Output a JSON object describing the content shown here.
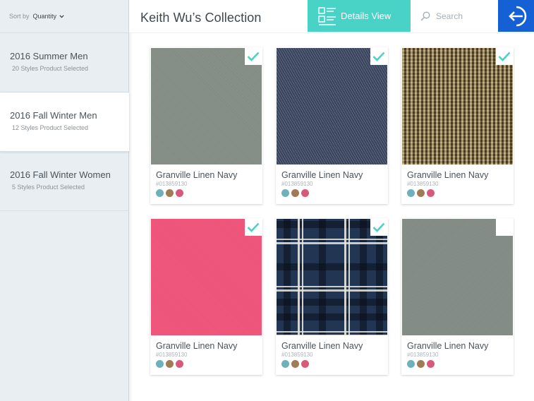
{
  "sidebar": {
    "sort_label": "Sort by",
    "sort_value": "Quantity",
    "collections": [
      {
        "name": "2016 Summer Men",
        "count": "20 Styles Product Selected",
        "active": false
      },
      {
        "name": "2016 Fall Winter Men",
        "count": "12 Styles Product Selected",
        "active": true
      },
      {
        "name": "2016 Fall Winter Women",
        "count": "5 Styles Product Selected",
        "active": false
      }
    ]
  },
  "header": {
    "title": "Keith Wu’s Collection",
    "details_label": "Details View",
    "search_placeholder": "Search",
    "search_value": ""
  },
  "colors": {
    "accent": "#49d3c7",
    "exit_button": "#1560d4",
    "dot_teal": "#6fb1bb",
    "dot_brown": "#a07b55",
    "dot_pink": "#d75a7c"
  },
  "products": [
    {
      "name": "Granville Linen Navy",
      "code": "#013859130",
      "fabric": "gray",
      "selected": true,
      "dots": [
        "#6fb1bb",
        "#a07b55",
        "#d75a7c"
      ]
    },
    {
      "name": "Granville Linen Navy",
      "code": "#013859130",
      "fabric": "denim",
      "selected": true,
      "dots": [
        "#6fb1bb",
        "#a07b55",
        "#d75a7c"
      ]
    },
    {
      "name": "Granville Linen Navy",
      "code": "#013859130",
      "fabric": "tweed",
      "selected": true,
      "dots": [
        "#6fb1bb",
        "#a07b55",
        "#d75a7c"
      ]
    },
    {
      "name": "Granville Linen Navy",
      "code": "#013859130",
      "fabric": "pink",
      "selected": true,
      "dots": [
        "#6fb1bb",
        "#a07b55",
        "#d75a7c"
      ]
    },
    {
      "name": "Granville Linen Navy",
      "code": "#013859130",
      "fabric": "plaid",
      "selected": true,
      "dots": [
        "#6fb1bb",
        "#a07b55",
        "#d75a7c"
      ]
    },
    {
      "name": "Granville Linen Navy",
      "code": "#013859130",
      "fabric": "gray2",
      "selected": false,
      "dots": [
        "#6fb1bb",
        "#a07b55",
        "#d75a7c"
      ]
    }
  ]
}
